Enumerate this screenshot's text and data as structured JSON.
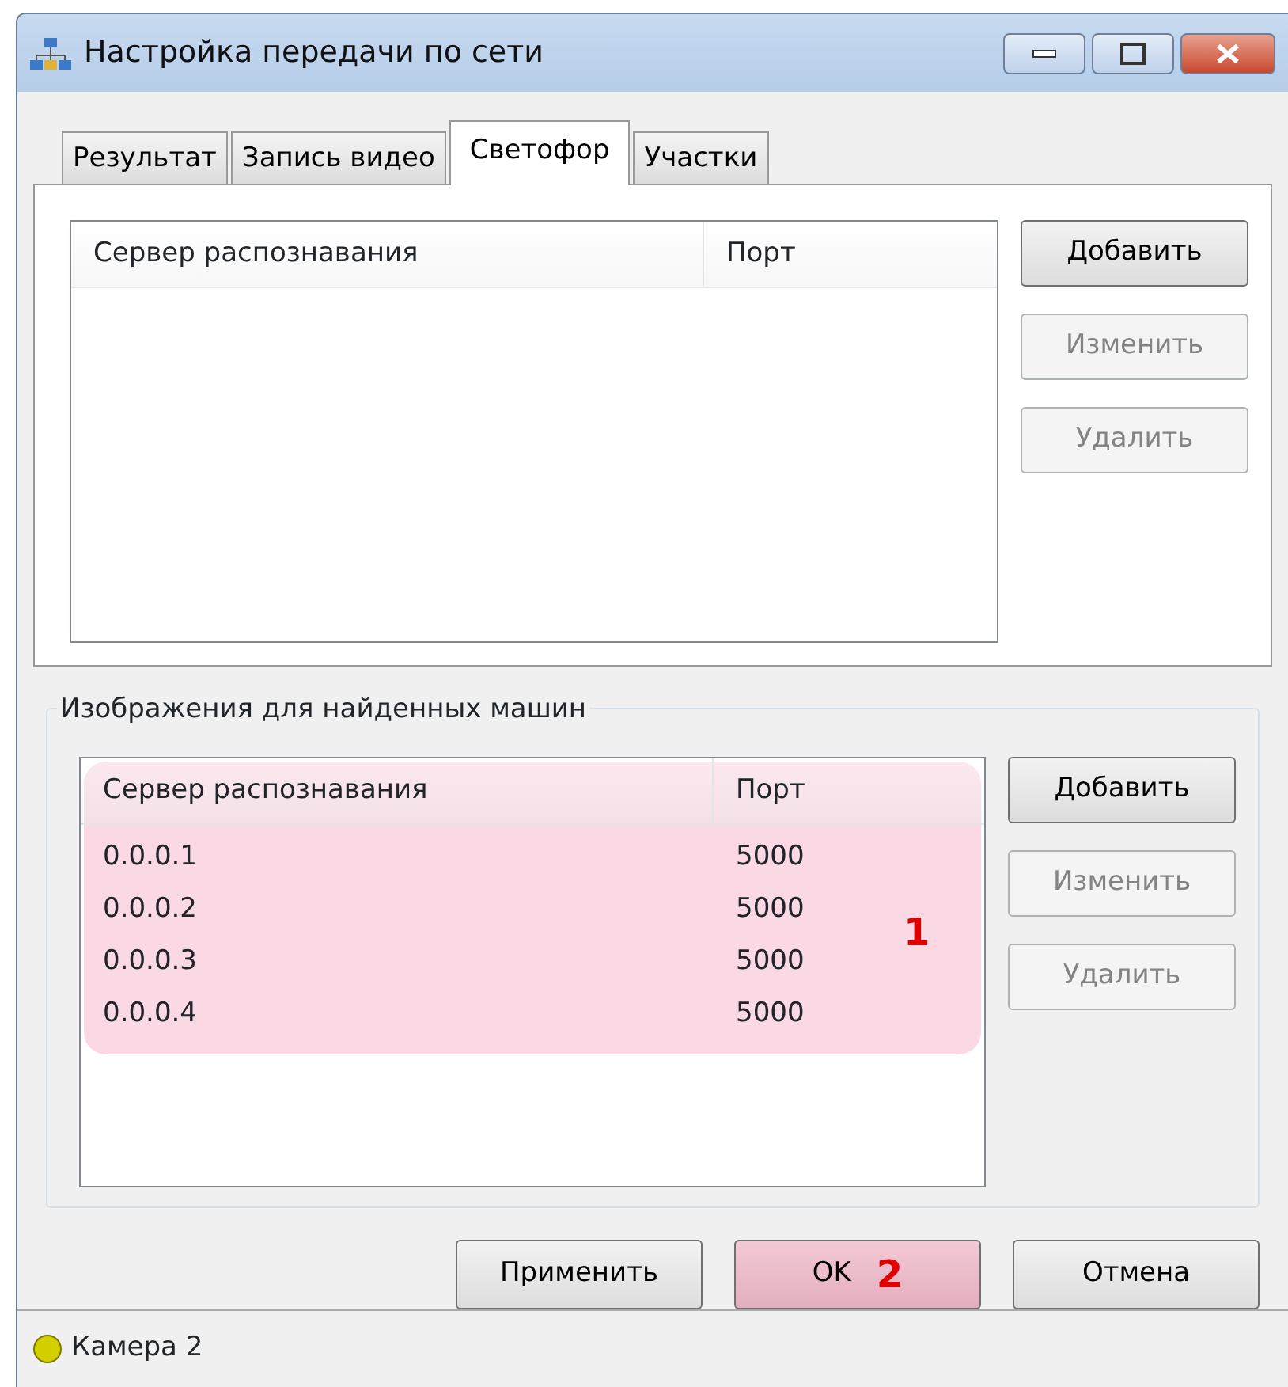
{
  "window": {
    "title": "Настройка передачи по сети"
  },
  "tabs": [
    {
      "label": "Результат",
      "selected": false
    },
    {
      "label": "Запись видео",
      "selected": false
    },
    {
      "label": "Светофор",
      "selected": true
    },
    {
      "label": "Участки",
      "selected": false
    }
  ],
  "traffic_light_list": {
    "columns": [
      "Сервер распознавания",
      "Порт"
    ],
    "buttons": [
      {
        "label": "Добавить",
        "disabled": false
      },
      {
        "label": "Изменить",
        "disabled": true
      },
      {
        "label": "Удалить",
        "disabled": true
      }
    ]
  },
  "found_cars_group": {
    "title": "Изображения для найденных машин",
    "highlighted": true,
    "annotation": "1",
    "columns": [
      "Сервер распознавания",
      "Порт"
    ],
    "rows": [
      [
        "0.0.0.1",
        "5000"
      ],
      [
        "0.0.0.2",
        "5000"
      ],
      [
        "0.0.0.3",
        "5000"
      ],
      [
        "0.0.0.4",
        "5000"
      ]
    ],
    "buttons": [
      {
        "label": "Добавить",
        "disabled": false
      },
      {
        "label": "Изменить",
        "disabled": true
      },
      {
        "label": "Удалить",
        "disabled": true
      }
    ]
  },
  "dialog_buttons": [
    {
      "label": "Применить",
      "highlighted": false
    },
    {
      "label": "OK",
      "highlighted": true,
      "annotation": "2"
    },
    {
      "label": "Отмена",
      "highlighted": false
    }
  ],
  "status_bar": {
    "text": "Камера 2",
    "color": "#d4d000"
  }
}
